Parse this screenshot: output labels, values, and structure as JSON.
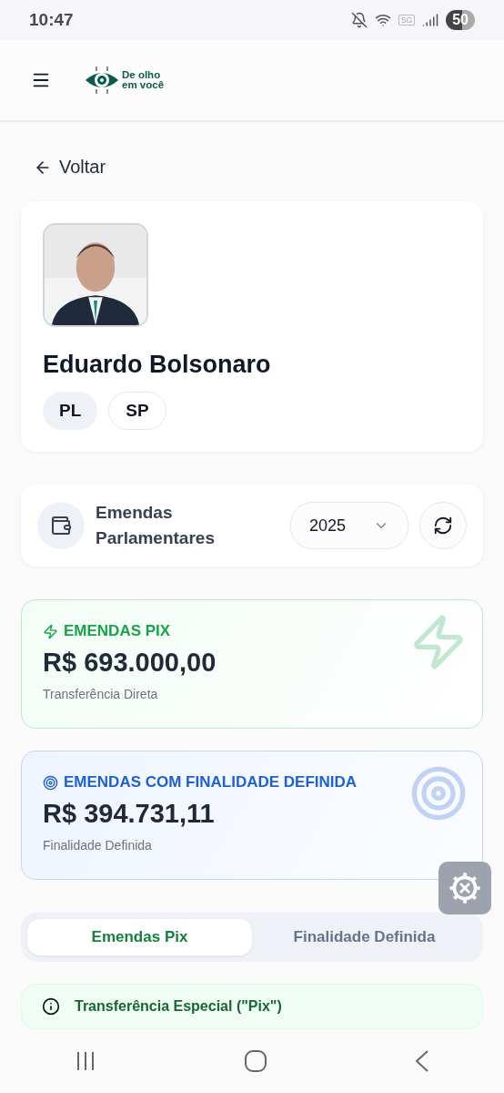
{
  "status_bar": {
    "time": "10:47",
    "network": "5G",
    "battery": "50"
  },
  "header": {
    "logo_text": [
      "De olho",
      "em você"
    ]
  },
  "back": {
    "label": "Voltar"
  },
  "profile": {
    "name": "Eduardo Bolsonaro",
    "tags": [
      {
        "label": "PL",
        "filled": true
      },
      {
        "label": "SP",
        "filled": false
      }
    ]
  },
  "section": {
    "title": "Emendas Parlamentares",
    "year": "2025"
  },
  "summary_cards": [
    {
      "kind": "pix",
      "label": "EMENDAS PIX",
      "amount": "R$ 693.000,00",
      "caption": "Transferência Direta"
    },
    {
      "kind": "target",
      "label": "EMENDAS COM FINALIDADE DEFINIDA",
      "amount": "R$ 394.731,11",
      "caption": "Finalidade Definida"
    }
  ],
  "tabs": [
    {
      "label": "Emendas Pix",
      "selected": true
    },
    {
      "label": "Finalidade Definida",
      "selected": false
    }
  ],
  "info": {
    "title": "Transferência Especial (\"Pix\")"
  }
}
